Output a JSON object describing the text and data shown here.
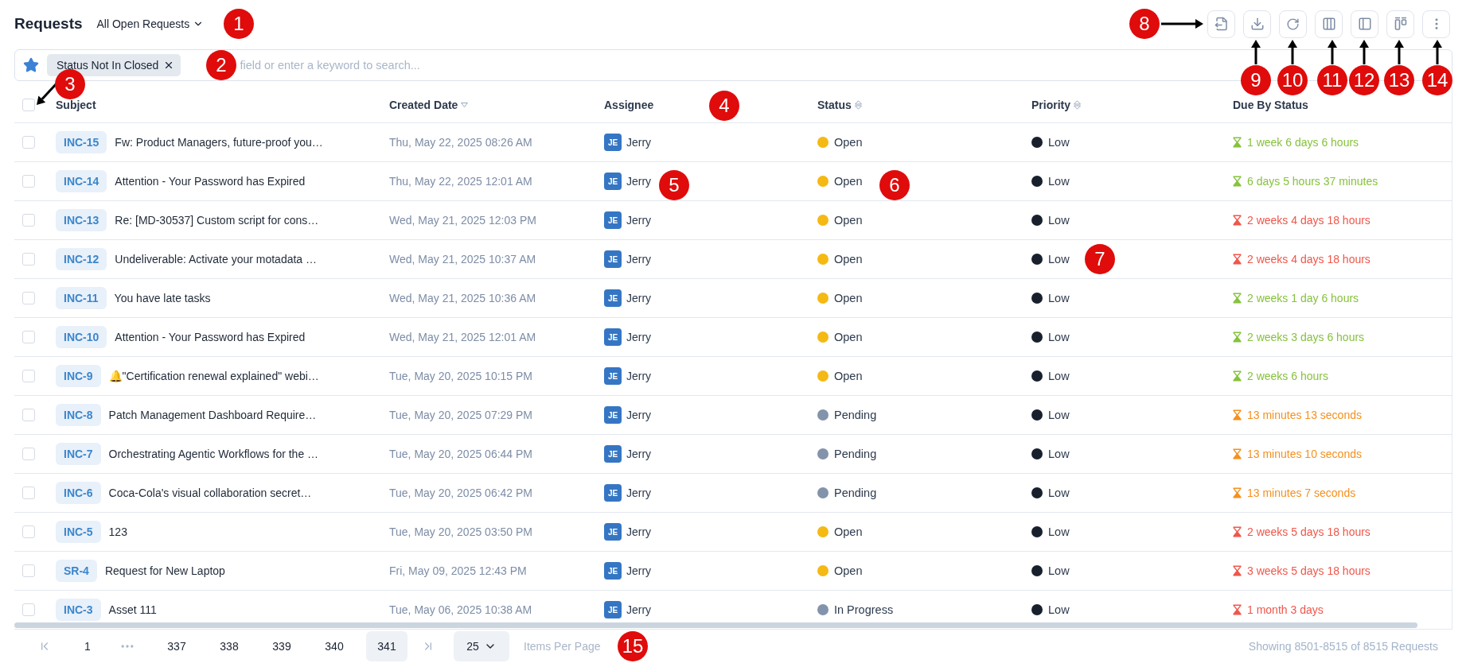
{
  "header": {
    "title": "Requests",
    "view": "All Open Requests"
  },
  "toolbar": [
    {
      "kind": "export"
    },
    {
      "kind": "download"
    },
    {
      "kind": "refresh"
    },
    {
      "kind": "columns"
    },
    {
      "kind": "panel"
    },
    {
      "kind": "board"
    },
    {
      "kind": "more"
    }
  ],
  "search": {
    "chips": [
      "Status Not In Closed"
    ],
    "placeholder": "field or enter a keyword to search..."
  },
  "table": {
    "select_all": {
      "checked": false
    },
    "columns": [
      {
        "label": "Subject"
      },
      {
        "label": "Created Date",
        "sorted": true
      },
      {
        "label": "Assignee"
      },
      {
        "label": "Status",
        "sorted": false
      },
      {
        "label": "Priority",
        "sorted": false
      },
      {
        "label": "Due By Status"
      }
    ],
    "rows": [
      {
        "checked": false,
        "id": "INC-15",
        "subject": "Fw: Product Managers, future-proof you…",
        "created": "Thu, May 22, 2025 08:26 AM",
        "assignee": {
          "initials": "JE",
          "name": "Jerry"
        },
        "status": {
          "label": "Open",
          "color": "#f5b914"
        },
        "priority": {
          "label": "Low",
          "color": "#18202e"
        },
        "due": {
          "text": "1 week 6 days 6 hours",
          "color": "#86c23c"
        }
      },
      {
        "checked": false,
        "id": "INC-14",
        "subject": "Attention - Your Password has Expired",
        "created": "Thu, May 22, 2025 12:01 AM",
        "assignee": {
          "initials": "JE",
          "name": "Jerry"
        },
        "status": {
          "label": "Open",
          "color": "#f5b914"
        },
        "priority": {
          "label": "Low",
          "color": "#18202e"
        },
        "due": {
          "text": "6 days 5 hours 37 minutes",
          "color": "#86c23c"
        }
      },
      {
        "checked": false,
        "id": "INC-13",
        "subject": "Re: [MD-30537] Custom script for cons…",
        "created": "Wed, May 21, 2025 12:03 PM",
        "assignee": {
          "initials": "JE",
          "name": "Jerry"
        },
        "status": {
          "label": "Open",
          "color": "#f5b914"
        },
        "priority": {
          "label": "Low",
          "color": "#18202e"
        },
        "due": {
          "text": "2 weeks 4 days 18 hours",
          "color": "#f0564a"
        }
      },
      {
        "checked": false,
        "id": "INC-12",
        "subject": "Undeliverable: Activate your motadata …",
        "created": "Wed, May 21, 2025 10:37 AM",
        "assignee": {
          "initials": "JE",
          "name": "Jerry"
        },
        "status": {
          "label": "Open",
          "color": "#f5b914"
        },
        "priority": {
          "label": "Low",
          "color": "#18202e"
        },
        "due": {
          "text": "2 weeks 4 days 18 hours",
          "color": "#f0564a"
        }
      },
      {
        "checked": false,
        "id": "INC-11",
        "subject": "You have late tasks",
        "created": "Wed, May 21, 2025 10:36 AM",
        "assignee": {
          "initials": "JE",
          "name": "Jerry"
        },
        "status": {
          "label": "Open",
          "color": "#f5b914"
        },
        "priority": {
          "label": "Low",
          "color": "#18202e"
        },
        "due": {
          "text": "2 weeks 1 day 6 hours",
          "color": "#86c23c"
        }
      },
      {
        "checked": false,
        "id": "INC-10",
        "subject": "Attention - Your Password has Expired",
        "created": "Wed, May 21, 2025 12:01 AM",
        "assignee": {
          "initials": "JE",
          "name": "Jerry"
        },
        "status": {
          "label": "Open",
          "color": "#f5b914"
        },
        "priority": {
          "label": "Low",
          "color": "#18202e"
        },
        "due": {
          "text": "2 weeks 3 days 6 hours",
          "color": "#86c23c"
        }
      },
      {
        "checked": false,
        "id": "INC-9",
        "subject": "🔔\"Certification renewal explained\" webi…",
        "created": "Tue, May 20, 2025 10:15 PM",
        "assignee": {
          "initials": "JE",
          "name": "Jerry"
        },
        "status": {
          "label": "Open",
          "color": "#f5b914"
        },
        "priority": {
          "label": "Low",
          "color": "#18202e"
        },
        "due": {
          "text": "2 weeks 6 hours",
          "color": "#86c23c"
        }
      },
      {
        "checked": false,
        "id": "INC-8",
        "subject": "Patch Management Dashboard Require…",
        "created": "Tue, May 20, 2025 07:29 PM",
        "assignee": {
          "initials": "JE",
          "name": "Jerry"
        },
        "status": {
          "label": "Pending",
          "color": "#8393ab"
        },
        "priority": {
          "label": "Low",
          "color": "#18202e"
        },
        "due": {
          "text": "13 minutes 13 seconds",
          "color": "#f5901e"
        }
      },
      {
        "checked": false,
        "id": "INC-7",
        "subject": "Orchestrating Agentic Workflows for the …",
        "created": "Tue, May 20, 2025 06:44 PM",
        "assignee": {
          "initials": "JE",
          "name": "Jerry"
        },
        "status": {
          "label": "Pending",
          "color": "#8393ab"
        },
        "priority": {
          "label": "Low",
          "color": "#18202e"
        },
        "due": {
          "text": "13 minutes 10 seconds",
          "color": "#f5901e"
        }
      },
      {
        "checked": false,
        "id": "INC-6",
        "subject": "Coca-Cola's visual collaboration secret…",
        "created": "Tue, May 20, 2025 06:42 PM",
        "assignee": {
          "initials": "JE",
          "name": "Jerry"
        },
        "status": {
          "label": "Pending",
          "color": "#8393ab"
        },
        "priority": {
          "label": "Low",
          "color": "#18202e"
        },
        "due": {
          "text": "13 minutes 7 seconds",
          "color": "#f5901e"
        }
      },
      {
        "checked": false,
        "id": "INC-5",
        "subject": "123",
        "created": "Tue, May 20, 2025 03:50 PM",
        "assignee": {
          "initials": "JE",
          "name": "Jerry"
        },
        "status": {
          "label": "Open",
          "color": "#f5b914"
        },
        "priority": {
          "label": "Low",
          "color": "#18202e"
        },
        "due": {
          "text": "2 weeks 5 days 18 hours",
          "color": "#f0564a"
        }
      },
      {
        "checked": false,
        "id": "SR-4",
        "subject": "Request for New Laptop",
        "created": "Fri, May 09, 2025 12:43 PM",
        "assignee": {
          "initials": "JE",
          "name": "Jerry"
        },
        "status": {
          "label": "Open",
          "color": "#f5b914"
        },
        "priority": {
          "label": "Low",
          "color": "#18202e"
        },
        "due": {
          "text": "3 weeks 5 days 18 hours",
          "color": "#f0564a"
        }
      },
      {
        "checked": false,
        "id": "INC-3",
        "subject": "Asset 111",
        "created": "Tue, May 06, 2025 10:38 AM",
        "assignee": {
          "initials": "JE",
          "name": "Jerry"
        },
        "status": {
          "label": "In Progress",
          "color": "#8393ab"
        },
        "priority": {
          "label": "Low",
          "color": "#18202e"
        },
        "due": {
          "text": "1 month 3 days",
          "color": "#f0564a"
        }
      }
    ]
  },
  "pagination": {
    "pages": [
      {
        "kind": "page",
        "label": "1",
        "selected": false
      },
      {
        "kind": "gap"
      },
      {
        "kind": "page",
        "label": "337",
        "selected": false
      },
      {
        "kind": "page",
        "label": "338",
        "selected": false
      },
      {
        "kind": "page",
        "label": "339",
        "selected": false
      },
      {
        "kind": "page",
        "label": "340",
        "selected": false
      },
      {
        "kind": "page",
        "label": "341",
        "selected": true
      }
    ],
    "per_page": {
      "value": "25",
      "label": "Items Per Page"
    },
    "summary": "Showing 8501-8515 of 8515 Requests"
  },
  "callouts": [
    {
      "number": "1"
    },
    {
      "number": "2"
    },
    {
      "number": "3"
    },
    {
      "number": "4"
    },
    {
      "number": "5"
    },
    {
      "number": "6"
    },
    {
      "number": "7"
    },
    {
      "number": "8"
    },
    {
      "number": "9"
    },
    {
      "number": "10"
    },
    {
      "number": "11"
    },
    {
      "number": "12"
    },
    {
      "number": "13"
    },
    {
      "number": "14"
    },
    {
      "number": "15"
    }
  ]
}
